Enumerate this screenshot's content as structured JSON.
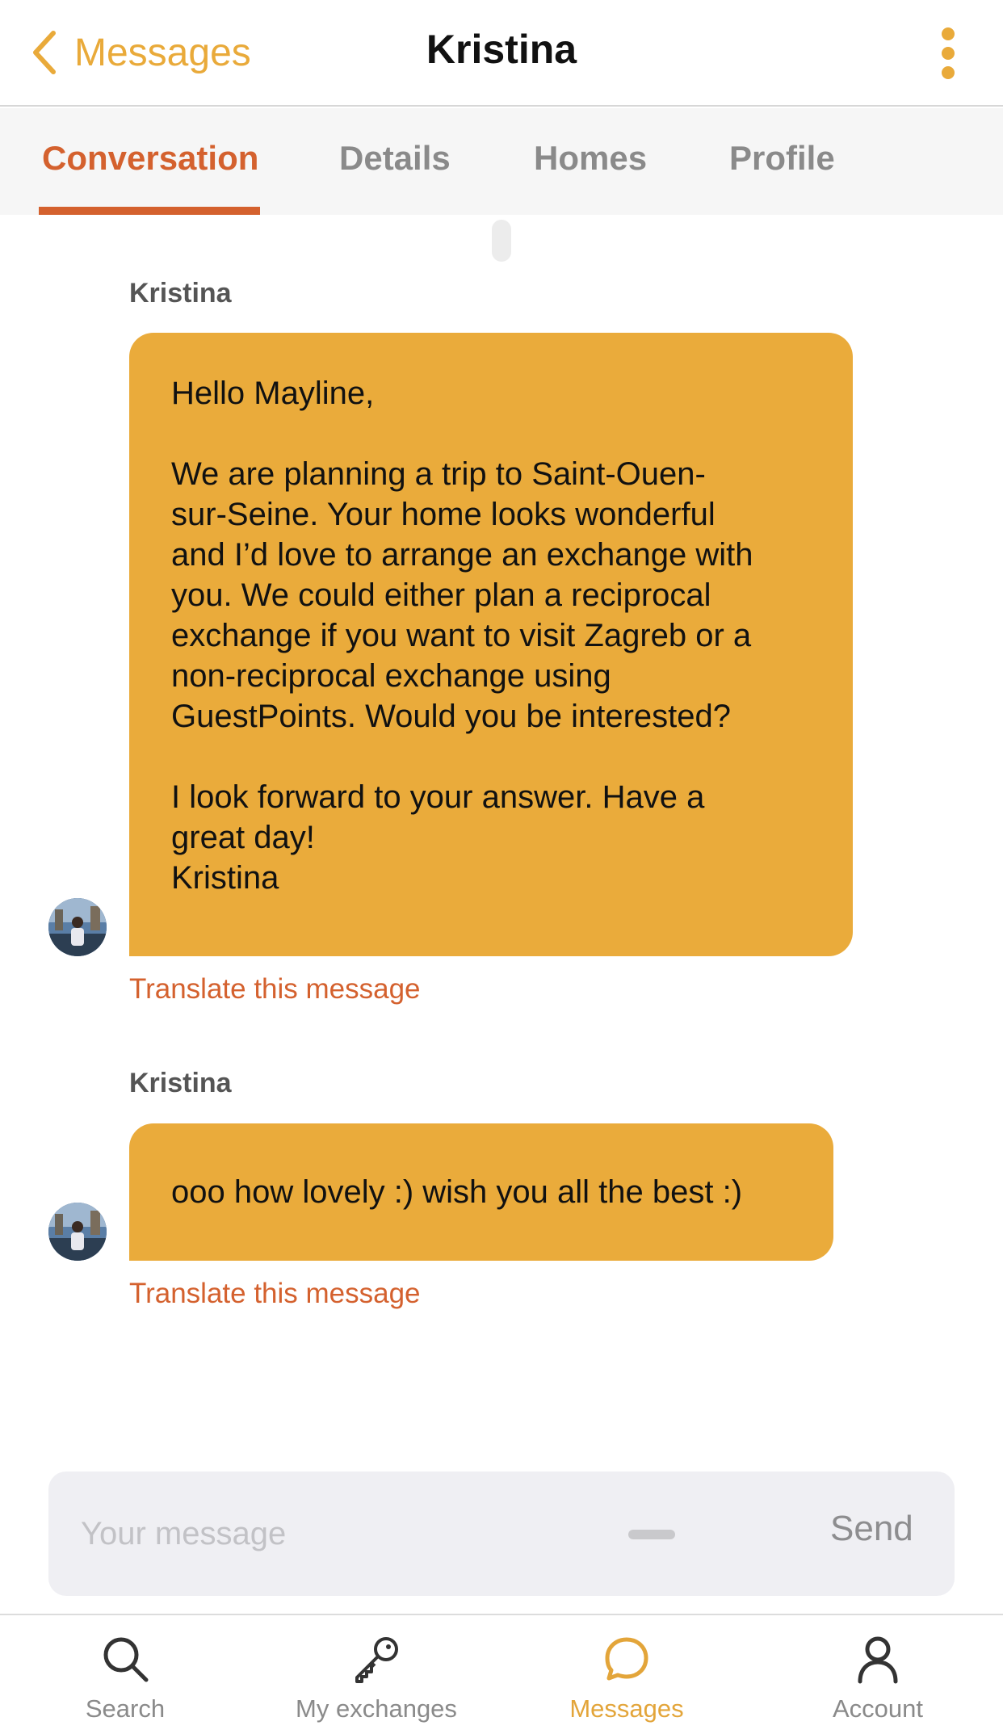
{
  "header": {
    "back_label": "Messages",
    "title": "Kristina",
    "icons": {
      "back": "chevron-left-icon",
      "more": "more-vertical-icon"
    }
  },
  "tabs": [
    {
      "label": "Conversation",
      "active": true
    },
    {
      "label": "Details",
      "active": false
    },
    {
      "label": "Homes",
      "active": false
    },
    {
      "label": "Profile",
      "active": false
    }
  ],
  "messages": [
    {
      "sender": "Kristina",
      "paragraphs": [
        "Hello Mayline,",
        "We are planning a trip to Saint-Ouen-\nsur-Seine. Your home looks wonderful\nand I’d love to arrange an exchange with\nyou. We could either plan a reciprocal\nexchange if you want to visit Zagreb or a\nnon-reciprocal exchange using\nGuestPoints. Would you be interested?",
        "I look forward to your answer. Have a\ngreat day!\nKristina"
      ],
      "translate_label": "Translate this message"
    },
    {
      "sender": "Kristina",
      "paragraphs": [
        "ooo how lovely :) wish you all the best :)"
      ],
      "translate_label": "Translate this message"
    }
  ],
  "composer": {
    "placeholder": "Your message",
    "value": "",
    "send_label": "Send"
  },
  "bottom_nav": [
    {
      "label": "Search",
      "icon": "search-icon",
      "active": false
    },
    {
      "label": "My exchanges",
      "icon": "key-icon",
      "active": false
    },
    {
      "label": "Messages",
      "icon": "chat-bubble-icon",
      "active": true
    },
    {
      "label": "Account",
      "icon": "user-icon",
      "active": false
    }
  ],
  "colors": {
    "accent_yellow": "#eaab3b",
    "accent_orange": "#d4612e",
    "inactive_gray": "#8a8a8a"
  }
}
